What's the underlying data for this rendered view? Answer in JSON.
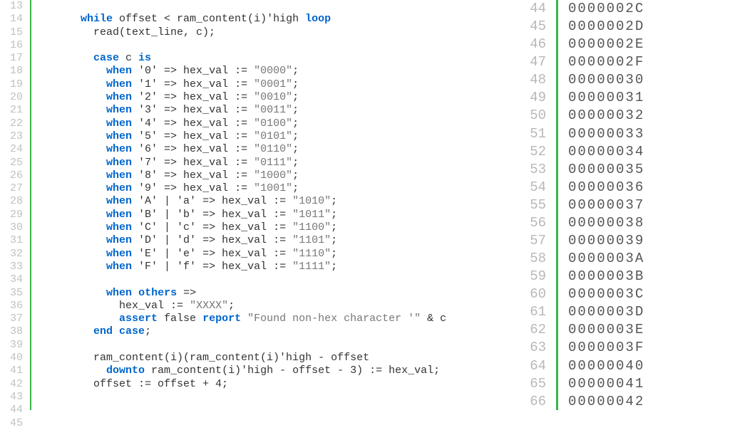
{
  "left": {
    "lines": [
      13,
      14,
      15,
      16,
      17,
      18,
      19,
      20,
      21,
      22,
      23,
      24,
      25,
      26,
      27,
      28,
      29,
      30,
      31,
      32,
      33,
      34,
      35,
      36,
      37,
      38,
      39,
      40,
      41,
      42,
      43,
      44,
      45
    ],
    "code": [
      {
        "indent": "",
        "tokens": []
      },
      {
        "indent": "       ",
        "tokens": [
          {
            "t": "kw",
            "v": "while"
          },
          {
            "t": "txt",
            "v": " offset < ram_content(i)'high "
          },
          {
            "t": "kw",
            "v": "loop"
          }
        ]
      },
      {
        "indent": "         ",
        "tokens": [
          {
            "t": "txt",
            "v": "read(text_line, c);"
          }
        ]
      },
      {
        "indent": "",
        "tokens": []
      },
      {
        "indent": "         ",
        "tokens": [
          {
            "t": "kw",
            "v": "case"
          },
          {
            "t": "txt",
            "v": " c "
          },
          {
            "t": "kw",
            "v": "is"
          }
        ]
      },
      {
        "indent": "           ",
        "tokens": [
          {
            "t": "kw",
            "v": "when"
          },
          {
            "t": "txt",
            "v": " '0' => hex_val := "
          },
          {
            "t": "str",
            "v": "\"0000\""
          },
          {
            "t": "txt",
            "v": ";"
          }
        ]
      },
      {
        "indent": "           ",
        "tokens": [
          {
            "t": "kw",
            "v": "when"
          },
          {
            "t": "txt",
            "v": " '1' => hex_val := "
          },
          {
            "t": "str",
            "v": "\"0001\""
          },
          {
            "t": "txt",
            "v": ";"
          }
        ]
      },
      {
        "indent": "           ",
        "tokens": [
          {
            "t": "kw",
            "v": "when"
          },
          {
            "t": "txt",
            "v": " '2' => hex_val := "
          },
          {
            "t": "str",
            "v": "\"0010\""
          },
          {
            "t": "txt",
            "v": ";"
          }
        ]
      },
      {
        "indent": "           ",
        "tokens": [
          {
            "t": "kw",
            "v": "when"
          },
          {
            "t": "txt",
            "v": " '3' => hex_val := "
          },
          {
            "t": "str",
            "v": "\"0011\""
          },
          {
            "t": "txt",
            "v": ";"
          }
        ]
      },
      {
        "indent": "           ",
        "tokens": [
          {
            "t": "kw",
            "v": "when"
          },
          {
            "t": "txt",
            "v": " '4' => hex_val := "
          },
          {
            "t": "str",
            "v": "\"0100\""
          },
          {
            "t": "txt",
            "v": ";"
          }
        ]
      },
      {
        "indent": "           ",
        "tokens": [
          {
            "t": "kw",
            "v": "when"
          },
          {
            "t": "txt",
            "v": " '5' => hex_val := "
          },
          {
            "t": "str",
            "v": "\"0101\""
          },
          {
            "t": "txt",
            "v": ";"
          }
        ]
      },
      {
        "indent": "           ",
        "tokens": [
          {
            "t": "kw",
            "v": "when"
          },
          {
            "t": "txt",
            "v": " '6' => hex_val := "
          },
          {
            "t": "str",
            "v": "\"0110\""
          },
          {
            "t": "txt",
            "v": ";"
          }
        ]
      },
      {
        "indent": "           ",
        "tokens": [
          {
            "t": "kw",
            "v": "when"
          },
          {
            "t": "txt",
            "v": " '7' => hex_val := "
          },
          {
            "t": "str",
            "v": "\"0111\""
          },
          {
            "t": "txt",
            "v": ";"
          }
        ]
      },
      {
        "indent": "           ",
        "tokens": [
          {
            "t": "kw",
            "v": "when"
          },
          {
            "t": "txt",
            "v": " '8' => hex_val := "
          },
          {
            "t": "str",
            "v": "\"1000\""
          },
          {
            "t": "txt",
            "v": ";"
          }
        ]
      },
      {
        "indent": "           ",
        "tokens": [
          {
            "t": "kw",
            "v": "when"
          },
          {
            "t": "txt",
            "v": " '9' => hex_val := "
          },
          {
            "t": "str",
            "v": "\"1001\""
          },
          {
            "t": "txt",
            "v": ";"
          }
        ]
      },
      {
        "indent": "           ",
        "tokens": [
          {
            "t": "kw",
            "v": "when"
          },
          {
            "t": "txt",
            "v": " 'A' | 'a' => hex_val := "
          },
          {
            "t": "str",
            "v": "\"1010\""
          },
          {
            "t": "txt",
            "v": ";"
          }
        ]
      },
      {
        "indent": "           ",
        "tokens": [
          {
            "t": "kw",
            "v": "when"
          },
          {
            "t": "txt",
            "v": " 'B' | 'b' => hex_val := "
          },
          {
            "t": "str",
            "v": "\"1011\""
          },
          {
            "t": "txt",
            "v": ";"
          }
        ]
      },
      {
        "indent": "           ",
        "tokens": [
          {
            "t": "kw",
            "v": "when"
          },
          {
            "t": "txt",
            "v": " 'C' | 'c' => hex_val := "
          },
          {
            "t": "str",
            "v": "\"1100\""
          },
          {
            "t": "txt",
            "v": ";"
          }
        ]
      },
      {
        "indent": "           ",
        "tokens": [
          {
            "t": "kw",
            "v": "when"
          },
          {
            "t": "txt",
            "v": " 'D' | 'd' => hex_val := "
          },
          {
            "t": "str",
            "v": "\"1101\""
          },
          {
            "t": "txt",
            "v": ";"
          }
        ]
      },
      {
        "indent": "           ",
        "tokens": [
          {
            "t": "kw",
            "v": "when"
          },
          {
            "t": "txt",
            "v": " 'E' | 'e' => hex_val := "
          },
          {
            "t": "str",
            "v": "\"1110\""
          },
          {
            "t": "txt",
            "v": ";"
          }
        ]
      },
      {
        "indent": "           ",
        "tokens": [
          {
            "t": "kw",
            "v": "when"
          },
          {
            "t": "txt",
            "v": " 'F' | 'f' => hex_val := "
          },
          {
            "t": "str",
            "v": "\"1111\""
          },
          {
            "t": "txt",
            "v": ";"
          }
        ]
      },
      {
        "indent": "",
        "tokens": []
      },
      {
        "indent": "           ",
        "tokens": [
          {
            "t": "kw",
            "v": "when"
          },
          {
            "t": "txt",
            "v": " "
          },
          {
            "t": "kw",
            "v": "others"
          },
          {
            "t": "txt",
            "v": " =>"
          }
        ]
      },
      {
        "indent": "             ",
        "tokens": [
          {
            "t": "txt",
            "v": "hex_val := "
          },
          {
            "t": "str",
            "v": "\"XXXX\""
          },
          {
            "t": "txt",
            "v": ";"
          }
        ]
      },
      {
        "indent": "             ",
        "tokens": [
          {
            "t": "kw",
            "v": "assert"
          },
          {
            "t": "txt",
            "v": " false "
          },
          {
            "t": "kw",
            "v": "report"
          },
          {
            "t": "txt",
            "v": " "
          },
          {
            "t": "str",
            "v": "\"Found non-hex character '\""
          },
          {
            "t": "txt",
            "v": " & c"
          }
        ]
      },
      {
        "indent": "         ",
        "tokens": [
          {
            "t": "kw",
            "v": "end"
          },
          {
            "t": "txt",
            "v": " "
          },
          {
            "t": "kw",
            "v": "case"
          },
          {
            "t": "txt",
            "v": ";"
          }
        ]
      },
      {
        "indent": "",
        "tokens": []
      },
      {
        "indent": "         ",
        "tokens": [
          {
            "t": "txt",
            "v": "ram_content(i)(ram_content(i)'high - offset"
          }
        ]
      },
      {
        "indent": "           ",
        "tokens": [
          {
            "t": "kw",
            "v": "downto"
          },
          {
            "t": "txt",
            "v": " ram_content(i)'high - offset - 3) := hex_val;"
          }
        ]
      },
      {
        "indent": "         ",
        "tokens": [
          {
            "t": "txt",
            "v": "offset := offset + 4;"
          }
        ]
      },
      {
        "indent": "",
        "tokens": []
      }
    ]
  },
  "right": {
    "lines": [
      44,
      45,
      46,
      47,
      48,
      49,
      50,
      51,
      52,
      53,
      54,
      55,
      56,
      57,
      58,
      59,
      60,
      61,
      62,
      63,
      64,
      65,
      66
    ],
    "values": [
      "0000002C",
      "0000002D",
      "0000002E",
      "0000002F",
      "00000030",
      "00000031",
      "00000032",
      "00000033",
      "00000034",
      "00000035",
      "00000036",
      "00000037",
      "00000038",
      "00000039",
      "0000003A",
      "0000003B",
      "0000003C",
      "0000003D",
      "0000003E",
      "0000003F",
      "00000040",
      "00000041",
      "00000042"
    ]
  }
}
